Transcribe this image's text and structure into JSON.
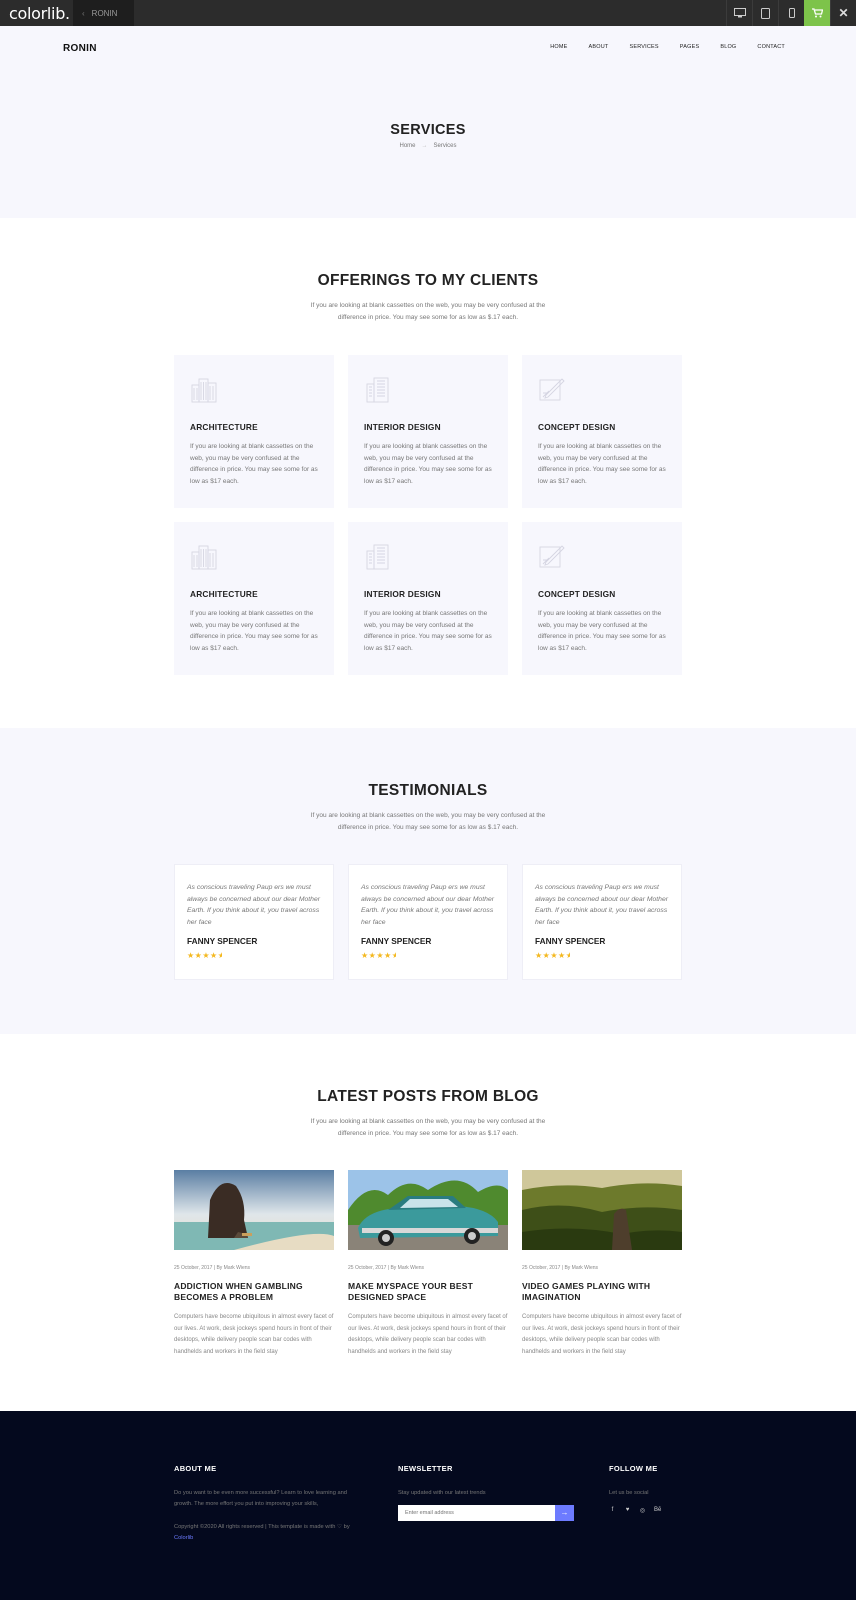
{
  "topbar": {
    "brand": "colorlib.",
    "theme_tab": "RONIN",
    "device_icons": [
      "desktop-icon",
      "tablet-icon",
      "mobile-icon"
    ],
    "cart_icon": "cart-icon",
    "close_icon": "close-icon",
    "accent": "#7dc34a"
  },
  "header": {
    "logo": "RONIN",
    "nav": [
      "HOME",
      "ABOUT",
      "SERVICES",
      "PAGES",
      "BLOG",
      "CONTACT"
    ]
  },
  "hero": {
    "title": "SERVICES",
    "breadcrumb": [
      "Home",
      "Services"
    ],
    "breadcrumb_separator": "→"
  },
  "services": {
    "title": "OFFERINGS TO MY CLIENTS",
    "subtitle": "If you are looking at blank cassettes on the web, you may be very confused at the difference in price. You may see some for as low as $.17 each.",
    "items": [
      {
        "icon": "buildings-icon",
        "name": "ARCHITECTURE",
        "desc": "If you are looking at blank cassettes on the web, you may be very confused at the difference in price. You may see some for as low as $17 each."
      },
      {
        "icon": "building-icon",
        "name": "INTERIOR DESIGN",
        "desc": "If you are looking at blank cassettes on the web, you may be very confused at the difference in price. You may see some for as low as $17 each."
      },
      {
        "icon": "drawing-icon",
        "name": "CONCEPT DESIGN",
        "desc": "If you are looking at blank cassettes on the web, you may be very confused at the difference in price. You may see some for as low as $17 each."
      },
      {
        "icon": "buildings-icon",
        "name": "ARCHITECTURE",
        "desc": "If you are looking at blank cassettes on the web, you may be very confused at the difference in price. You may see some for as low as $17 each."
      },
      {
        "icon": "building-icon",
        "name": "INTERIOR DESIGN",
        "desc": "If you are looking at blank cassettes on the web, you may be very confused at the difference in price. You may see some for as low as $17 each."
      },
      {
        "icon": "drawing-icon",
        "name": "CONCEPT DESIGN",
        "desc": "If you are looking at blank cassettes on the web, you may be very confused at the difference in price. You may see some for as low as $17 each."
      }
    ]
  },
  "testimonials": {
    "title": "TESTIMONIALS",
    "subtitle": "If you are looking at blank cassettes on the web, you may be very confused at the difference in price. You may see some for as low as $.17 each.",
    "items": [
      {
        "quote": "As conscious traveling Paup ers we must always be concerned about our dear Mother Earth. If you think about it, you travel across her face",
        "author": "FANNY SPENCER",
        "rating": 4.5
      },
      {
        "quote": "As conscious traveling Paup ers we must always be concerned about our dear Mother Earth. If you think about it, you travel across her face",
        "author": "FANNY SPENCER",
        "rating": 4.5
      },
      {
        "quote": "As conscious traveling Paup ers we must always be concerned about our dear Mother Earth. If you think about it, you travel across her face",
        "author": "FANNY SPENCER",
        "rating": 4.5
      }
    ],
    "star_color": "#f4b81f"
  },
  "blog": {
    "title": "LATEST POSTS FROM BLOG",
    "subtitle": "If you are looking at blank cassettes on the web, you may be very confused at the difference in price. You may see some for as low as $.17 each.",
    "posts": [
      {
        "meta": "25 October, 2017 | By Mark Wiens",
        "title": "ADDICTION WHEN GAMBLING BECOMES A PROBLEM",
        "excerpt": "Computers have become ubiquitous in almost every facet of our lives. At work, desk jockeys spend hours in front of their desktops, while delivery people scan bar codes with handhelds and workers in the field stay"
      },
      {
        "meta": "25 October, 2017 | By Mark Wiens",
        "title": "MAKE MYSPACE YOUR BEST DESIGNED SPACE",
        "excerpt": "Computers have become ubiquitous in almost every facet of our lives. At work, desk jockeys spend hours in front of their desktops, while delivery people scan bar codes with handhelds and workers in the field stay"
      },
      {
        "meta": "25 October, 2017 | By Mark Wiens",
        "title": "VIDEO GAMES PLAYING WITH IMAGINATION",
        "excerpt": "Computers have become ubiquitous in almost every facet of our lives. At work, desk jockeys spend hours in front of their desktops, while delivery people scan bar codes with handhelds and workers in the field stay"
      }
    ]
  },
  "footer": {
    "about": {
      "title": "ABOUT ME",
      "text": "Do you want to be even more successful? Learn to love learning and growth. The more effort you put into improving your skills,",
      "copyright": "Copyright ©2020 All rights reserved | This template is made with ♡ by",
      "copyright_link": "Colorlib"
    },
    "newsletter": {
      "title": "NEWSLETTER",
      "text": "Stay updated with our latest trends",
      "placeholder": "Enter email address",
      "button_icon": "arrow-right-icon",
      "accent": "#6d7bff"
    },
    "follow": {
      "title": "FOLLOW ME",
      "text": "Let us be social",
      "icons": [
        "facebook-icon",
        "twitter-icon",
        "dribbble-icon",
        "behance-icon"
      ]
    },
    "background": "#04091e"
  }
}
